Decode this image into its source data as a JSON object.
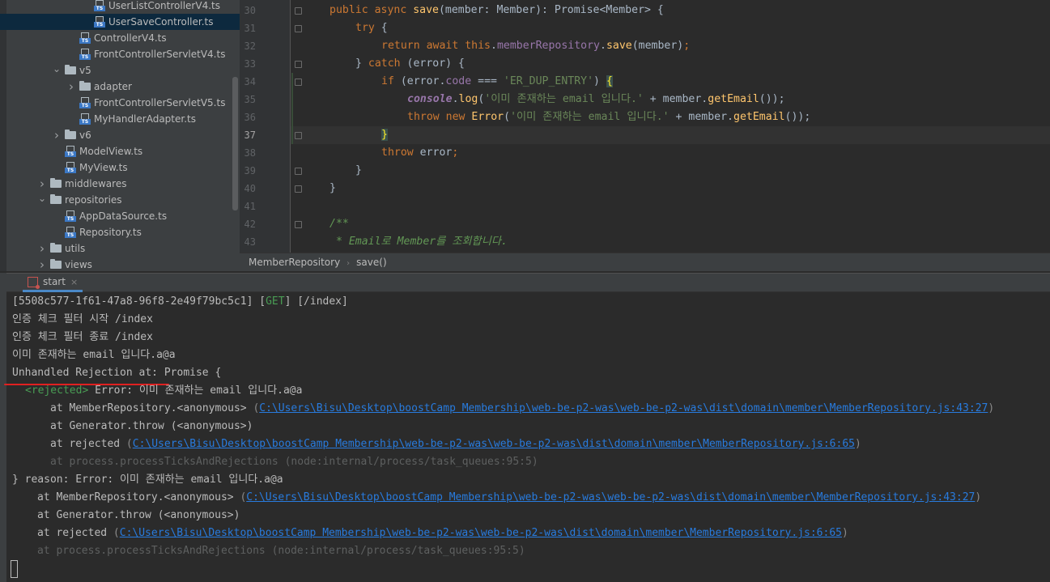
{
  "project_tree": [
    {
      "label": "UserListControllerV4.ts",
      "kind": "ts",
      "indent": 5,
      "clipped": true
    },
    {
      "label": "UserSaveController.ts",
      "kind": "ts",
      "indent": 5,
      "selected": true
    },
    {
      "label": "ControllerV4.ts",
      "kind": "ts",
      "indent": 4
    },
    {
      "label": "FrontControllerServletV4.ts",
      "kind": "ts",
      "indent": 4
    },
    {
      "label": "v5",
      "kind": "folder",
      "indent": 3,
      "arrow": "down"
    },
    {
      "label": "adapter",
      "kind": "folder",
      "indent": 4,
      "arrow": "right"
    },
    {
      "label": "FrontControllerServletV5.ts",
      "kind": "ts",
      "indent": 4
    },
    {
      "label": "MyHandlerAdapter.ts",
      "kind": "ts",
      "indent": 4
    },
    {
      "label": "v6",
      "kind": "folder",
      "indent": 3,
      "arrow": "right"
    },
    {
      "label": "ModelView.ts",
      "kind": "ts",
      "indent": 3
    },
    {
      "label": "MyView.ts",
      "kind": "ts",
      "indent": 3
    },
    {
      "label": "middlewares",
      "kind": "folder",
      "indent": 2,
      "arrow": "right"
    },
    {
      "label": "repositories",
      "kind": "folder",
      "indent": 2,
      "arrow": "down"
    },
    {
      "label": "AppDataSource.ts",
      "kind": "ts",
      "indent": 3
    },
    {
      "label": "Repository.ts",
      "kind": "ts",
      "indent": 3
    },
    {
      "label": "utils",
      "kind": "folder",
      "indent": 2,
      "arrow": "right"
    },
    {
      "label": "views",
      "kind": "folder",
      "indent": 2,
      "arrow": "right"
    }
  ],
  "line_numbers": [
    "30",
    "31",
    "32",
    "33",
    "34",
    "35",
    "36",
    "37",
    "38",
    "39",
    "40",
    "41",
    "42",
    "43"
  ],
  "current_line": "37",
  "breadcrumb": {
    "class_name": "MemberRepository",
    "method": "save()",
    "separator": "›"
  },
  "run_tab": {
    "label": "start",
    "close": "×"
  },
  "code_tokens": {
    "public_async": "public async ",
    "save": "save",
    "sig": "(member: Member): Promise<Member> {",
    "try": "try",
    "brace_open": " {",
    "return_await_this": "return await this",
    "dot": ".",
    "memberRepository": "memberRepository",
    "save_call_args": "(member)",
    "semicolon": ";",
    "close_catch": "} ",
    "catch": "catch",
    "catch_args": " (error) {",
    "if": "if",
    "if_cond_a": " (error.",
    "code_field": "code",
    "if_cond_b": " === ",
    "dup_entry": "'ER_DUP_ENTRY'",
    "if_cond_c": ") ",
    "brace_hl": "{",
    "console": "console",
    "log": "log",
    "open_paren": "(",
    "msg_str": "'이미 존재하는 email 입니다.'",
    "plus_member": " + member.",
    "getEmail": "getEmail",
    "close_call": "());",
    "throw_new": "throw new ",
    "Error": "Error",
    "brace_close_hl": "}",
    "throw": "throw",
    "error_semi": " error",
    "close_brace": "}",
    "doc_open": "/**",
    "doc_line": " * Email로 Member를 조회합니다."
  },
  "console": {
    "request_line_a": "[5508c577-1f61-47a8-96f8-2e49f79bc5c1] [",
    "request_method": "GET",
    "request_line_b": "] [/index]",
    "auth_start": "인증 체크 필터 시작 /index",
    "auth_end": "인증 체크 필터 종료 /index",
    "exists_msg": "이미 존재하는 email 입니다.a@a",
    "unhandled": "Unhandled Rejection at: Promise {",
    "rejected_tag": "<rejected>",
    "rejected_msg": " Error: 이미 존재하는 email 입니다.a@a",
    "at_member_repo": "at MemberRepository.<anonymous> ",
    "at_generator_throw": "at Generator.throw (<anonymous>)",
    "at_rejected": "at rejected ",
    "at_process_ticks": "at process.processTicksAndRejections (node:internal/process/task_queues:95:5)",
    "path_43_27": "C:\\Users\\Bisu\\Desktop\\boostCamp Membership\\web-be-p2-was\\web-be-p2-was\\dist\\domain\\member\\MemberRepository.js:43:27",
    "path_6_65": "C:\\Users\\Bisu\\Desktop\\boostCamp Membership\\web-be-p2-was\\web-be-p2-was\\dist\\domain\\member\\MemberRepository.js:6:65",
    "paren_open": "(",
    "paren_close": ")",
    "reason_line": "} reason: Error: 이미 존재하는 email 입니다.a@a"
  }
}
